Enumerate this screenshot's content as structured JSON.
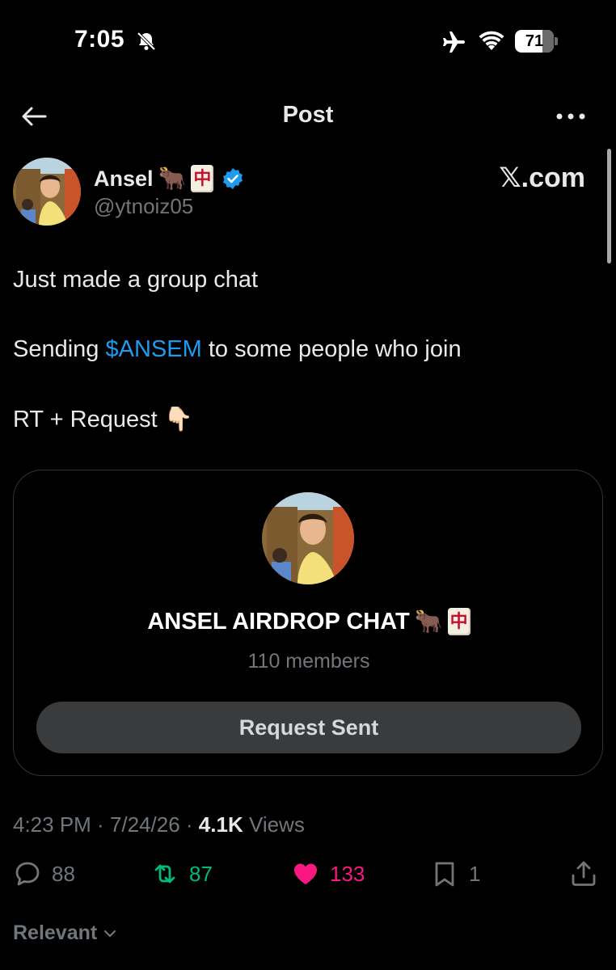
{
  "status_bar": {
    "time": "7:05",
    "battery": "71",
    "battery_level": 0.71,
    "icons": [
      "bell-slash-icon",
      "airplane-icon",
      "wifi-icon",
      "battery-icon"
    ]
  },
  "header": {
    "title": "Post",
    "icons": [
      "back-arrow-icon",
      "more-icon"
    ]
  },
  "author": {
    "name": "Ansel",
    "handle": "@ytnoiz05",
    "emoji_ox": "🐂",
    "mahjong": "中",
    "verified": true,
    "source": "𝕏.com"
  },
  "post": {
    "line1": "Just made a group chat",
    "line2_prefix": "Sending ",
    "cashtag": "$ANSEM",
    "line2_suffix": " to some people who join",
    "line3": "RT + Request ",
    "line3_emoji": "👇🏻"
  },
  "group_card": {
    "title": "ANSEL AIRDROP CHAT",
    "emoji_ox": "🐂",
    "mahjong": "中",
    "members": "110 members",
    "button_label": "Request Sent"
  },
  "meta": {
    "time": "4:23 PM",
    "separator": " · ",
    "date": "7/24/26",
    "views_count": "4.1K",
    "views_label": " Views"
  },
  "actions": {
    "replies": "88",
    "reposts": "87",
    "likes": "133",
    "bookmarks": "1"
  },
  "replies_sort": {
    "label": "Relevant"
  },
  "colors": {
    "background": "#000000",
    "link": "#1d9bf0",
    "repost": "#00ba7c",
    "like": "#f91880",
    "muted": "#71767b",
    "verified": "#1d9bf0"
  }
}
